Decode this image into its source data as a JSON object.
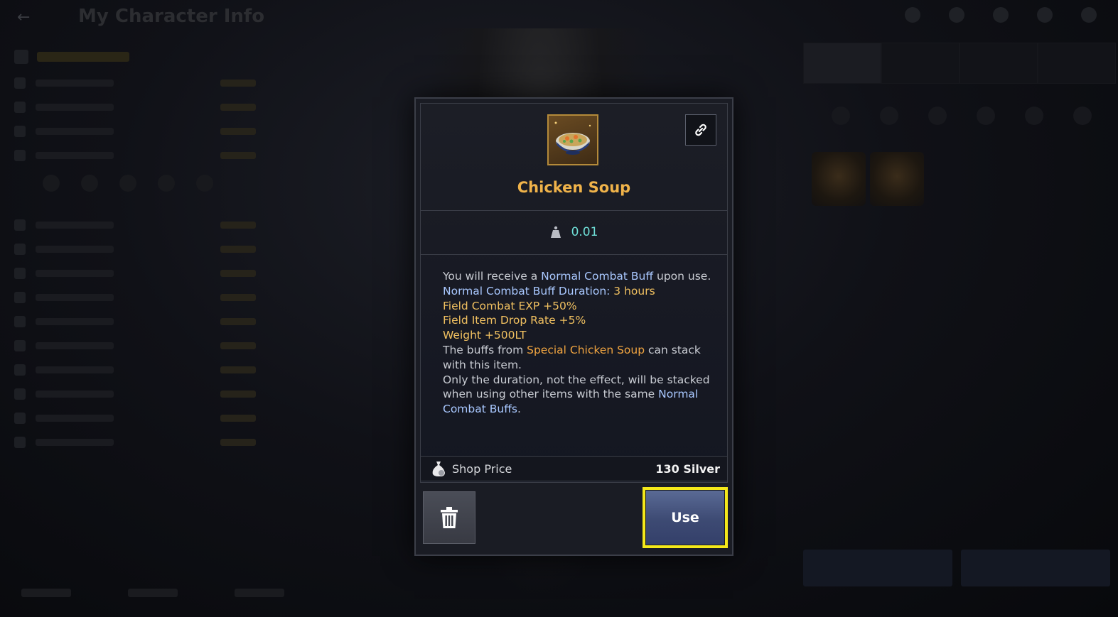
{
  "background": {
    "page_title": "My Character Info"
  },
  "popup": {
    "item_icon": "chicken-soup-bowl-icon",
    "link_icon": "link-chain-icon",
    "item_name": "Chicken Soup",
    "weight_icon": "weight-icon",
    "weight_value": "0.01",
    "description": {
      "line1_pre": "You will receive a ",
      "line1_hl": "Normal Combat Buff",
      "line1_post": " upon use.",
      "duration_label": "Normal Combat Buff Duration: ",
      "duration_value": "3 hours",
      "effect1": "Field Combat EXP +50%",
      "effect2": "Field Item Drop Rate +5%",
      "effect3": "Weight +500LT",
      "stack_pre": "The buffs from ",
      "stack_hl": "Special Chicken Soup",
      "stack_post": " can stack with this item.",
      "note_pre": "Only the duration, not the effect, will be stacked when using other items with the same ",
      "note_hl": "Normal Combat Buffs",
      "note_post": "."
    },
    "price_icon": "silver-bag-icon",
    "price_label": "Shop Price",
    "price_value": "130 Silver",
    "delete_icon": "trash-icon",
    "use_label": "Use"
  },
  "colors": {
    "item_name": "#f0b34a",
    "highlight_blue": "#a9c8ff",
    "highlight_gold": "#f0c060",
    "weight_value": "#6fe0d8",
    "use_outline": "#f4e81a"
  }
}
